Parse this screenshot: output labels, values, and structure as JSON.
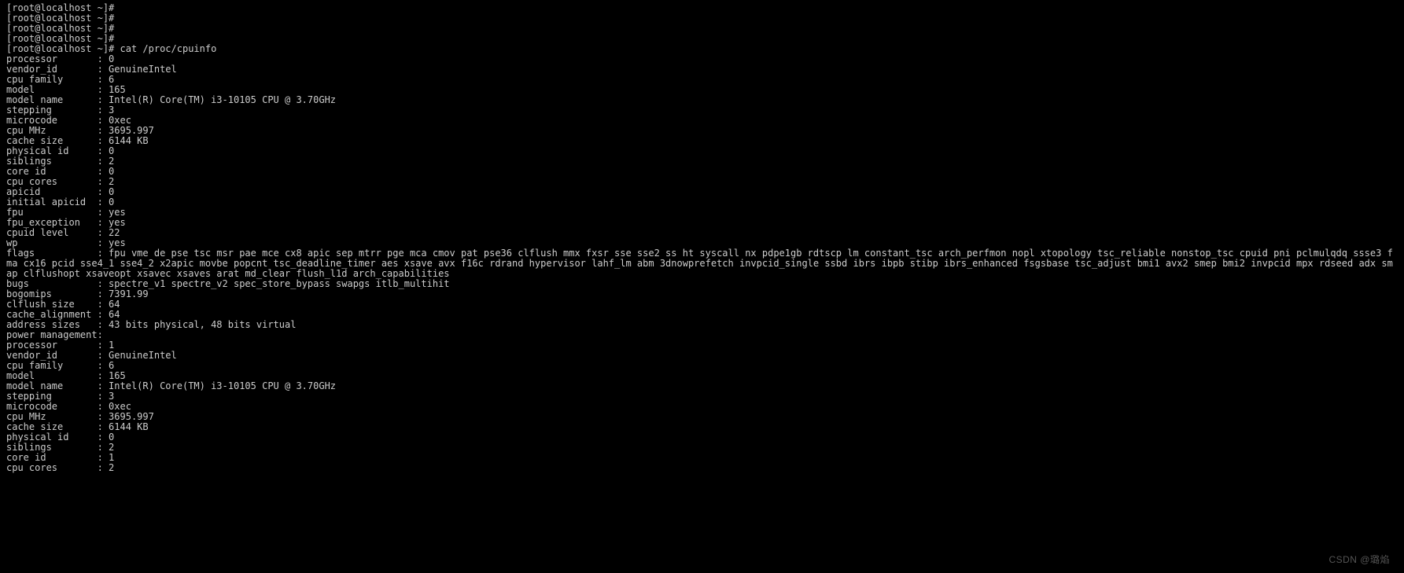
{
  "prompt": "[root@localhost ~]#",
  "command": "cat /proc/cpuinfo",
  "label_width": 16,
  "cpu0": {
    "processor": "0",
    "vendor_id": "GenuineIntel",
    "cpu_family": "6",
    "model": "165",
    "model_name": "Intel(R) Core(TM) i3-10105 CPU @ 3.70GHz",
    "stepping": "3",
    "microcode": "0xec",
    "cpu_MHz": "3695.997",
    "cache_size": "6144 KB",
    "physical_id": "0",
    "siblings": "2",
    "core_id": "0",
    "cpu_cores": "2",
    "apicid": "0",
    "initial_apicid": "0",
    "fpu": "yes",
    "fpu_exception": "yes",
    "cpuid_level": "22",
    "wp": "yes",
    "flags": "fpu vme de pse tsc msr pae mce cx8 apic sep mtrr pge mca cmov pat pse36 clflush mmx fxsr sse sse2 ss ht syscall nx pdpe1gb rdtscp lm constant_tsc arch_perfmon nopl xtopology tsc_reliable nonstop_tsc cpuid pni pclmulqdq ssse3 fma cx16 pcid sse4_1 sse4_2 x2apic movbe popcnt tsc_deadline_timer aes xsave avx f16c rdrand hypervisor lahf_lm abm 3dnowprefetch invpcid_single ssbd ibrs ibpb stibp ibrs_enhanced fsgsbase tsc_adjust bmi1 avx2 smep bmi2 invpcid mpx rdseed adx smap clflushopt xsaveopt xsavec xsaves arat md_clear flush_l1d arch_capabilities",
    "bugs": "spectre_v1 spectre_v2 spec_store_bypass swapgs itlb_multihit",
    "bogomips": "7391.99",
    "clflush_size": "64",
    "cache_alignment": "64",
    "address_sizes": "43 bits physical, 48 bits virtual",
    "power_management": ""
  },
  "cpu1": {
    "processor": "1",
    "vendor_id": "GenuineIntel",
    "cpu_family": "6",
    "model": "165",
    "model_name": "Intel(R) Core(TM) i3-10105 CPU @ 3.70GHz",
    "stepping": "3",
    "microcode": "0xec",
    "cpu_MHz": "3695.997",
    "cache_size": "6144 KB",
    "physical_id": "0",
    "siblings": "2",
    "core_id": "1",
    "cpu_cores": "2"
  },
  "watermark": "CSDN @璐焰"
}
